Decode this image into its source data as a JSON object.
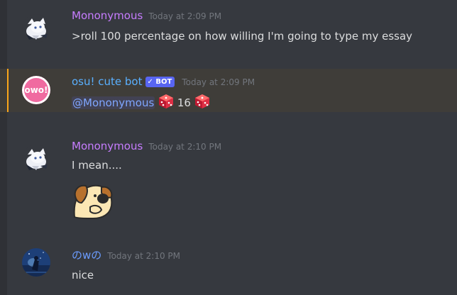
{
  "messages": [
    {
      "author": "Mononymous",
      "timestamp": "Today at 2:09 PM",
      "avatar": "anime-girl-avatar",
      "text": ">roll 100 percentage on how willing I'm going to type my essay"
    },
    {
      "author": "osu! cute bot",
      "badge": "✓ BOT",
      "timestamp": "Today at 2:09 PM",
      "avatar_text": "owo!",
      "avatar_color": "#f06aa0",
      "mention": "@Mononymous",
      "roll_value": "16",
      "icon": "game-die-icon"
    },
    {
      "author": "Mononymous",
      "timestamp": "Today at 2:10 PM",
      "avatar": "anime-girl-avatar",
      "text": "I mean....",
      "emoji": "dog-emoji"
    },
    {
      "author": "のwの",
      "timestamp": "Today at 2:10 PM",
      "avatar": "night-scene-avatar",
      "text": "nice"
    }
  ],
  "colors": {
    "background": "#36393f",
    "highlight": "#3f3d39",
    "highlight_bar": "#faa61a",
    "username_purple": "#c77dff",
    "username_blue": "#5ab0ff",
    "bot_badge": "#5865f2",
    "timestamp": "#72767d",
    "text": "#dcddde"
  }
}
